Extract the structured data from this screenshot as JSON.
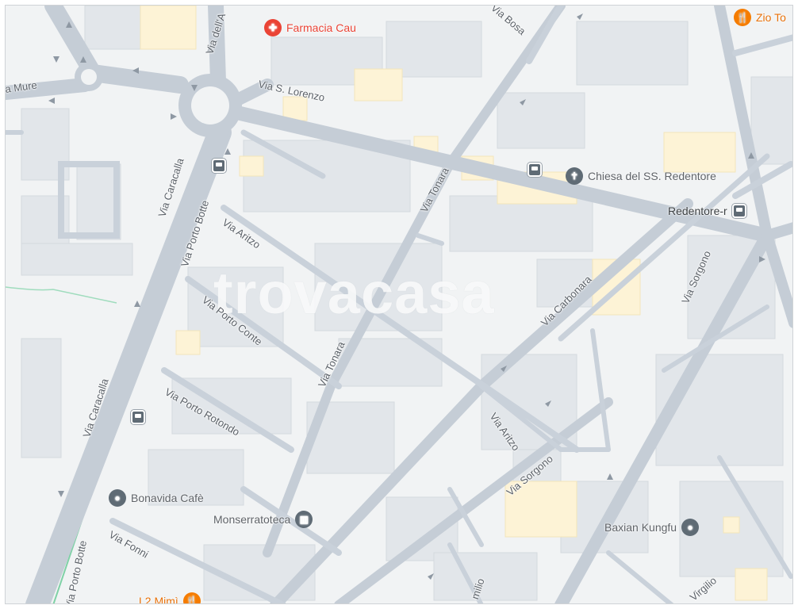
{
  "map": {
    "watermark": "trovacasa",
    "colors": {
      "background": "#f1f3f4",
      "road": "#c5cdd6",
      "building": "#e2e6ea",
      "highlight_building": "#fdf3d6",
      "pharmacy": "#ea4335",
      "restaurant": "#f57c00",
      "place": "#5f6b75",
      "green_line": "#7fd1a6"
    },
    "pois": [
      {
        "name": "Farmacia Cau",
        "icon": "pharmacy-icon"
      },
      {
        "name": "Zio To",
        "icon": "restaurant-icon"
      },
      {
        "name": "Chiesa del SS. Redentore",
        "icon": "church-icon"
      },
      {
        "name": "Redentore-r",
        "icon": "bus-stop-icon"
      },
      {
        "name": "Bonavida Cafè",
        "icon": "place-icon"
      },
      {
        "name": "Monserratoteca",
        "icon": "library-icon"
      },
      {
        "name": "Baxian Kungfu",
        "icon": "place-icon"
      },
      {
        "name": "L2 Mimì",
        "icon": "restaurant-icon"
      }
    ],
    "streets": [
      "Via S. Lorenzo",
      "Via Caracalla",
      "Via Caracalla",
      "Via Porto Botte",
      "Via Porto Botte",
      "Via Aritzo",
      "Via Aritzo",
      "Via Porto Conte",
      "Via Porto Rotondo",
      "Via Fonni",
      "Via Tonara",
      "Via Tonara",
      "Via Carbonara",
      "Via Sorgono",
      "Via Sorgono",
      "Via Bosa",
      "Via dell'A",
      "Via Mure",
      "Virgilio",
      "milio"
    ]
  }
}
